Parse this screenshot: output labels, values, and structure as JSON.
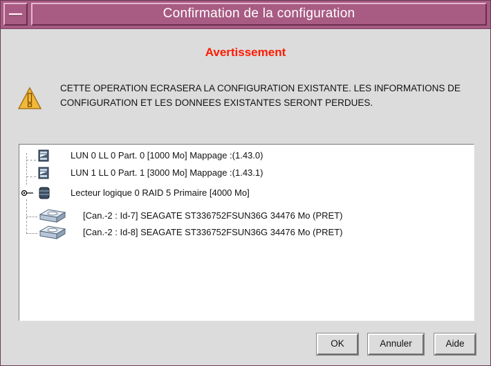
{
  "window": {
    "title": "Confirmation de la configuration"
  },
  "warning": {
    "heading": "Avertissement",
    "message": "CETTE OPERATION ECRASERA LA CONFIGURATION EXISTANTE. LES INFORMATIONS DE CONFIGURATION ET LES DONNEES EXISTANTES SERONT PERDUES.",
    "icon": "warning-triangle-icon",
    "color": "#ff1a00"
  },
  "tree": {
    "items": [
      {
        "label": "LUN 0 LL 0 Part. 0 [1000 Mo] Mappage :(1.43.0)",
        "icon": "lun-icon"
      },
      {
        "label": "LUN 1 LL 0 Part. 1 [3000 Mo] Mappage :(1.43.1)",
        "icon": "lun-icon"
      },
      {
        "label": "Lecteur logique 0 RAID 5 Primaire [4000 Mo]",
        "icon": "logical-drive-icon"
      },
      {
        "label": "[Can.-2 : Id-7] SEAGATE ST336752FSUN36G 34476 Mo (PRET)",
        "icon": "disk-drive-icon"
      },
      {
        "label": "[Can.-2 : Id-8] SEAGATE ST336752FSUN36G 34476 Mo (PRET)",
        "icon": "disk-drive-icon"
      }
    ]
  },
  "buttons": {
    "ok": "OK",
    "cancel": "Annuler",
    "help": "Aide"
  },
  "colors": {
    "titlebar": "#a85b83",
    "background": "#dcdcdc"
  }
}
